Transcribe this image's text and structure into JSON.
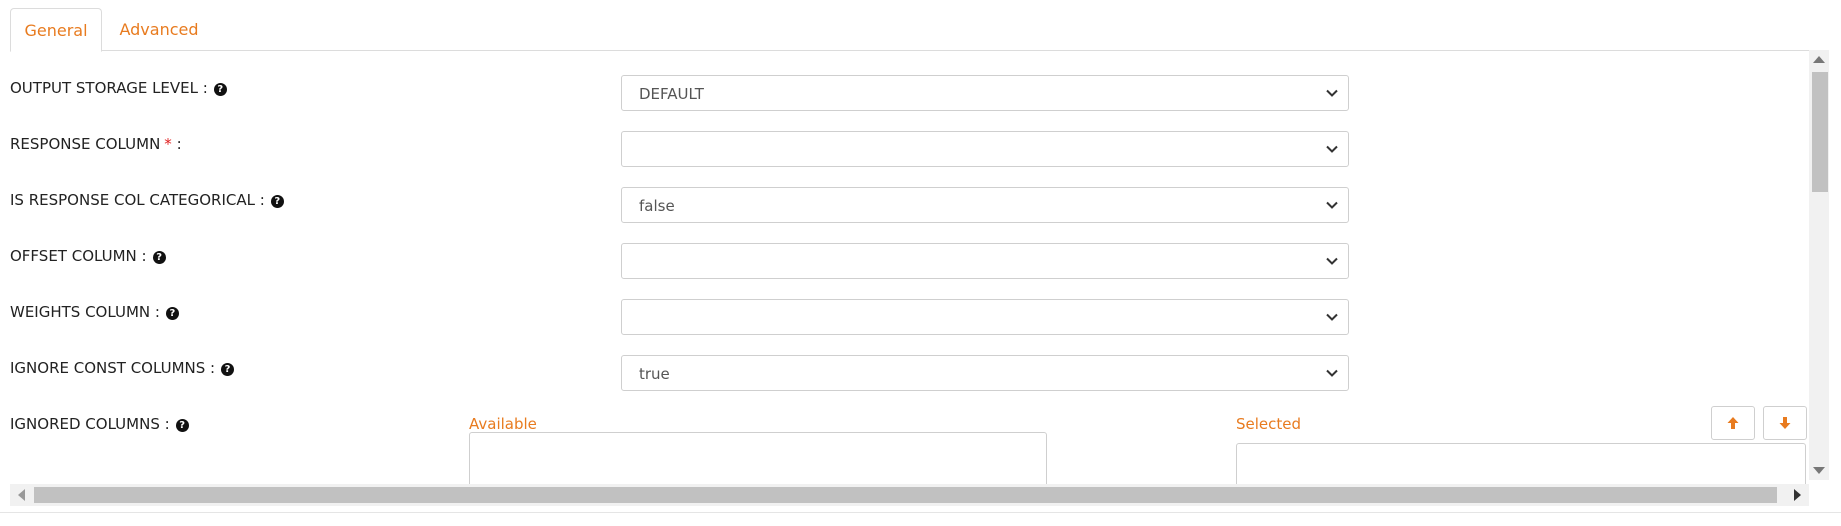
{
  "tabs": {
    "general": "General",
    "advanced": "Advanced"
  },
  "fields": {
    "output_storage_level": {
      "label": "OUTPUT STORAGE LEVEL :",
      "value": "DEFAULT"
    },
    "response_column": {
      "label": "RESPONSE COLUMN",
      "required_mark": "*",
      "suffix": ":",
      "value": ""
    },
    "is_response_col_categorical": {
      "label": "IS RESPONSE COL CATEGORICAL :",
      "value": "false"
    },
    "offset_column": {
      "label": "OFFSET COLUMN :",
      "value": ""
    },
    "weights_column": {
      "label": "WEIGHTS COLUMN :",
      "value": ""
    },
    "ignore_const_columns": {
      "label": "IGNORE CONST COLUMNS :",
      "value": "true"
    },
    "ignored_columns": {
      "label": "IGNORED COLUMNS :",
      "available_header": "Available",
      "selected_header": "Selected"
    }
  },
  "icons": {
    "help": "question-circle-icon",
    "dropdown": "chevron-down-icon",
    "move_up": "arrow-up-icon",
    "move_down": "arrow-down-icon"
  },
  "colors": {
    "accent": "#e87b1f",
    "required": "#e02020"
  }
}
